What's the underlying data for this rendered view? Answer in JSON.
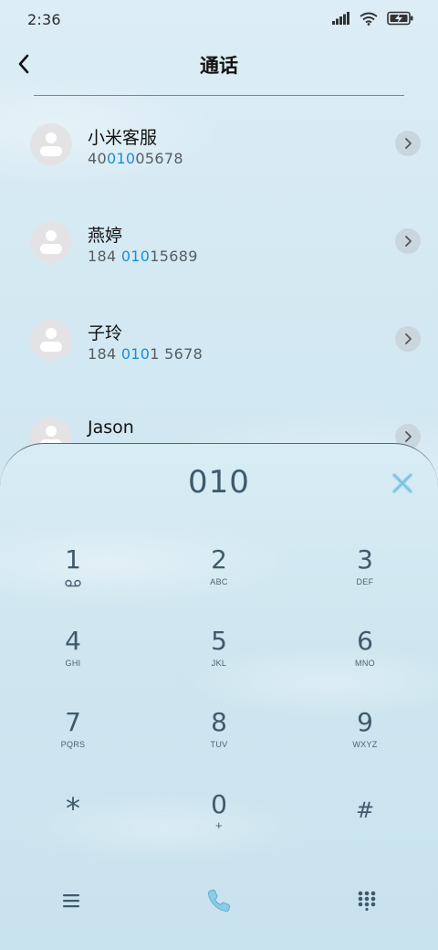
{
  "status_bar": {
    "time": "2:36"
  },
  "header": {
    "title": "通话"
  },
  "contacts": [
    {
      "name": "小米客服",
      "number_parts": [
        {
          "text": "40",
          "highlight": false
        },
        {
          "text": "010",
          "highlight": true
        },
        {
          "text": "05678",
          "highlight": false
        }
      ]
    },
    {
      "name": "燕婷",
      "number_parts": [
        {
          "text": "184 ",
          "highlight": false
        },
        {
          "text": "010",
          "highlight": true
        },
        {
          "text": "15689",
          "highlight": false
        }
      ]
    },
    {
      "name": "子玲",
      "number_parts": [
        {
          "text": "184 ",
          "highlight": false
        },
        {
          "text": "010",
          "highlight": true
        },
        {
          "text": "1 5678",
          "highlight": false
        }
      ]
    },
    {
      "name": "Jason",
      "number_parts": []
    }
  ],
  "dialpad": {
    "input": "010",
    "keys": [
      {
        "digit": "1",
        "letters": "",
        "sub_icon": "voicemail-icon"
      },
      {
        "digit": "2",
        "letters": "ABC"
      },
      {
        "digit": "3",
        "letters": "DEF"
      },
      {
        "digit": "4",
        "letters": "GHI"
      },
      {
        "digit": "5",
        "letters": "JKL"
      },
      {
        "digit": "6",
        "letters": "MNO"
      },
      {
        "digit": "7",
        "letters": "PQRS"
      },
      {
        "digit": "8",
        "letters": "TUV"
      },
      {
        "digit": "9",
        "letters": "WXYZ"
      },
      {
        "digit": "*",
        "letters": ""
      },
      {
        "digit": "0",
        "letters": "+"
      },
      {
        "digit": "#",
        "letters": ""
      }
    ]
  },
  "bottom_bar": {
    "icons": [
      "menu-icon",
      "phone-call-icon",
      "dialpad-toggle-icon"
    ]
  },
  "colors": {
    "accent_blue": "#1a8fd6",
    "digit_color": "#3f5a6c",
    "call_icon": "#5aaed6"
  }
}
